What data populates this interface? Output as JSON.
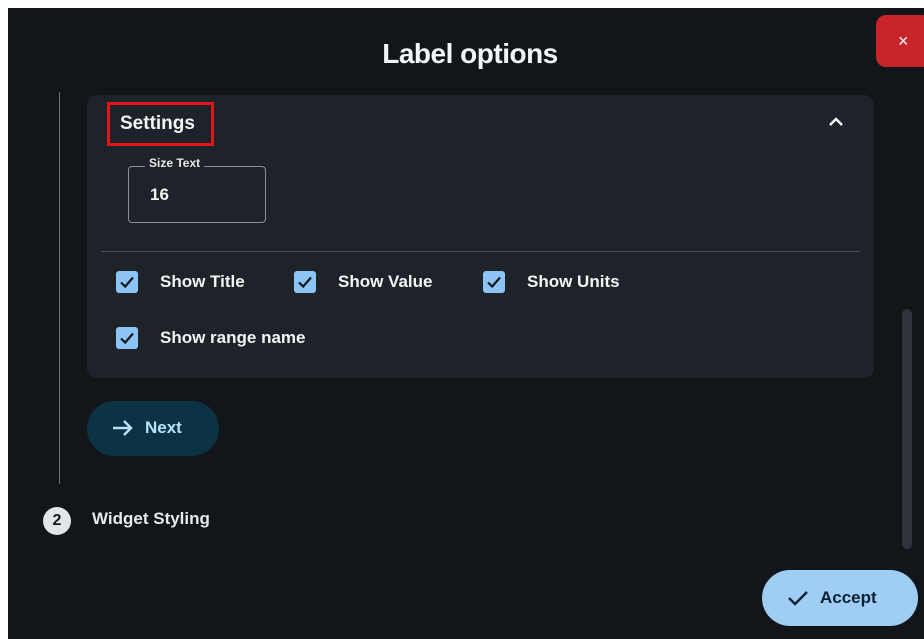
{
  "dialog": {
    "title": "Label options",
    "close_label": "×"
  },
  "settings": {
    "header_label": "Settings",
    "expanded": true,
    "size_text": {
      "label": "Size Text",
      "value": "16"
    },
    "checkboxes": [
      {
        "label": "Show Title",
        "checked": true
      },
      {
        "label": "Show Value",
        "checked": true
      },
      {
        "label": "Show Units",
        "checked": true
      },
      {
        "label": "Show range name",
        "checked": true
      }
    ]
  },
  "next_button": {
    "label": "Next"
  },
  "steps": [
    {
      "number": "2",
      "label": "Widget Styling"
    }
  ],
  "accept_button": {
    "label": "Accept"
  },
  "colors": {
    "background": "#12161b",
    "card": "#1e2329",
    "close": "#c8252b",
    "checkbox": "#8dc4f6",
    "accept": "#9fcdf3",
    "next": "#0b3344",
    "highlight": "#e0161c"
  }
}
